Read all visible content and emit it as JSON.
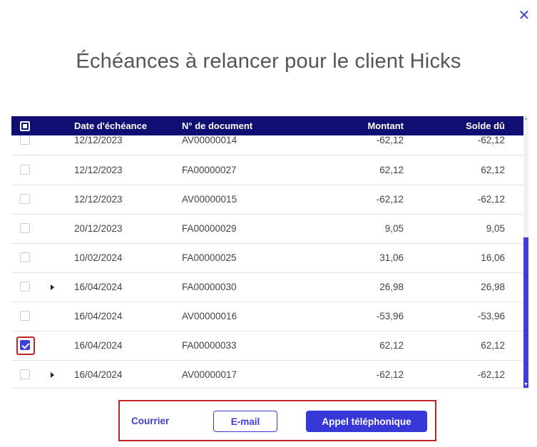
{
  "dialog": {
    "title": "Échéances à relancer pour le client Hicks",
    "close_icon": "✕"
  },
  "table": {
    "columns": {
      "date": "Date d'échéance",
      "document": "N° de document",
      "amount": "Montant",
      "balance": "Solde dû"
    },
    "rows": [
      {
        "date": "12/12/2023",
        "document": "AV00000014",
        "amount": "-62,12",
        "balance": "-62,12",
        "checked": false,
        "expandable": false
      },
      {
        "date": "12/12/2023",
        "document": "FA00000027",
        "amount": "62,12",
        "balance": "62,12",
        "checked": false,
        "expandable": false
      },
      {
        "date": "12/12/2023",
        "document": "AV00000015",
        "amount": "-62,12",
        "balance": "-62,12",
        "checked": false,
        "expandable": false
      },
      {
        "date": "20/12/2023",
        "document": "FA00000029",
        "amount": "9,05",
        "balance": "9,05",
        "checked": false,
        "expandable": false
      },
      {
        "date": "10/02/2024",
        "document": "FA00000025",
        "amount": "31,06",
        "balance": "16,06",
        "checked": false,
        "expandable": false
      },
      {
        "date": "16/04/2024",
        "document": "FA00000030",
        "amount": "26,98",
        "balance": "26,98",
        "checked": false,
        "expandable": true
      },
      {
        "date": "16/04/2024",
        "document": "AV00000016",
        "amount": "-53,96",
        "balance": "-53,96",
        "checked": false,
        "expandable": false
      },
      {
        "date": "16/04/2024",
        "document": "FA00000033",
        "amount": "62,12",
        "balance": "62,12",
        "checked": true,
        "expandable": false
      },
      {
        "date": "16/04/2024",
        "document": "AV00000017",
        "amount": "-62,12",
        "balance": "-62,12",
        "checked": false,
        "expandable": true
      }
    ]
  },
  "actions": {
    "mail_label": "Courrier",
    "email_label": "E-mail",
    "phone_label": "Appel téléphonique"
  },
  "colors": {
    "header_bg": "#0f0e72",
    "accent": "#3f3fd6",
    "highlight": "#c0242b"
  },
  "scroll": {
    "position_fraction": 0.55
  }
}
